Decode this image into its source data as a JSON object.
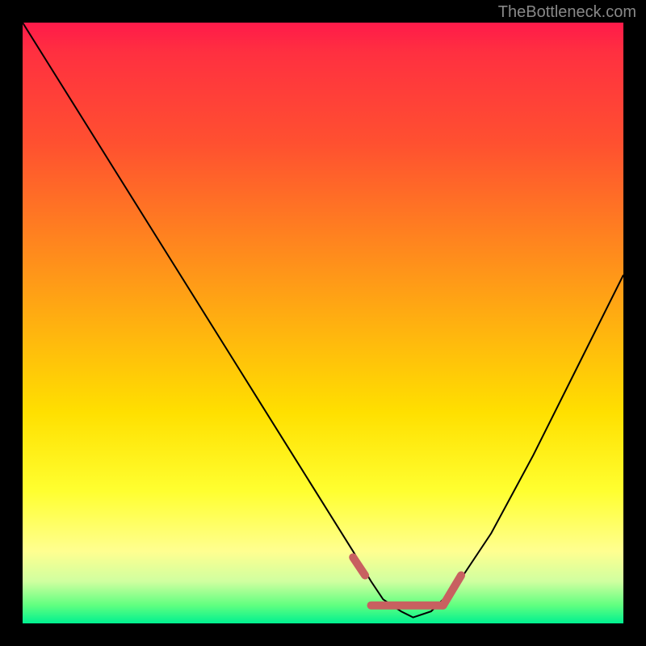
{
  "watermark": "TheBottleneck.com",
  "chart_data": {
    "type": "line",
    "title": "",
    "xlabel": "",
    "ylabel": "",
    "xlim": [
      0,
      100
    ],
    "ylim": [
      0,
      100
    ],
    "grid": false,
    "series": [
      {
        "name": "bottleneck-curve",
        "x": [
          0,
          5,
          10,
          15,
          20,
          25,
          30,
          35,
          40,
          45,
          50,
          55,
          58,
          60,
          63,
          65,
          68,
          72,
          78,
          85,
          92,
          100
        ],
        "y": [
          100,
          92,
          84,
          76,
          68,
          60,
          52,
          44,
          36,
          28,
          20,
          12,
          7,
          4,
          2,
          1,
          2,
          6,
          15,
          28,
          42,
          58
        ],
        "color": "#000000"
      }
    ],
    "annotations": [
      {
        "name": "optimal-marker-left",
        "x_range": [
          55,
          57
        ],
        "y_range": [
          11,
          8
        ],
        "color": "#c86060"
      },
      {
        "name": "optimal-marker-flat",
        "x_range": [
          58,
          70
        ],
        "y_range": [
          3,
          3
        ],
        "color": "#c86060"
      },
      {
        "name": "optimal-marker-right",
        "x_range": [
          70,
          73
        ],
        "y_range": [
          3,
          8
        ],
        "color": "#c86060"
      }
    ],
    "background_gradient": {
      "type": "vertical",
      "stops": [
        {
          "pos": 0,
          "color": "#ff1a4a"
        },
        {
          "pos": 20,
          "color": "#ff5030"
        },
        {
          "pos": 50,
          "color": "#ffb010"
        },
        {
          "pos": 78,
          "color": "#ffff30"
        },
        {
          "pos": 100,
          "color": "#00f090"
        }
      ]
    }
  }
}
